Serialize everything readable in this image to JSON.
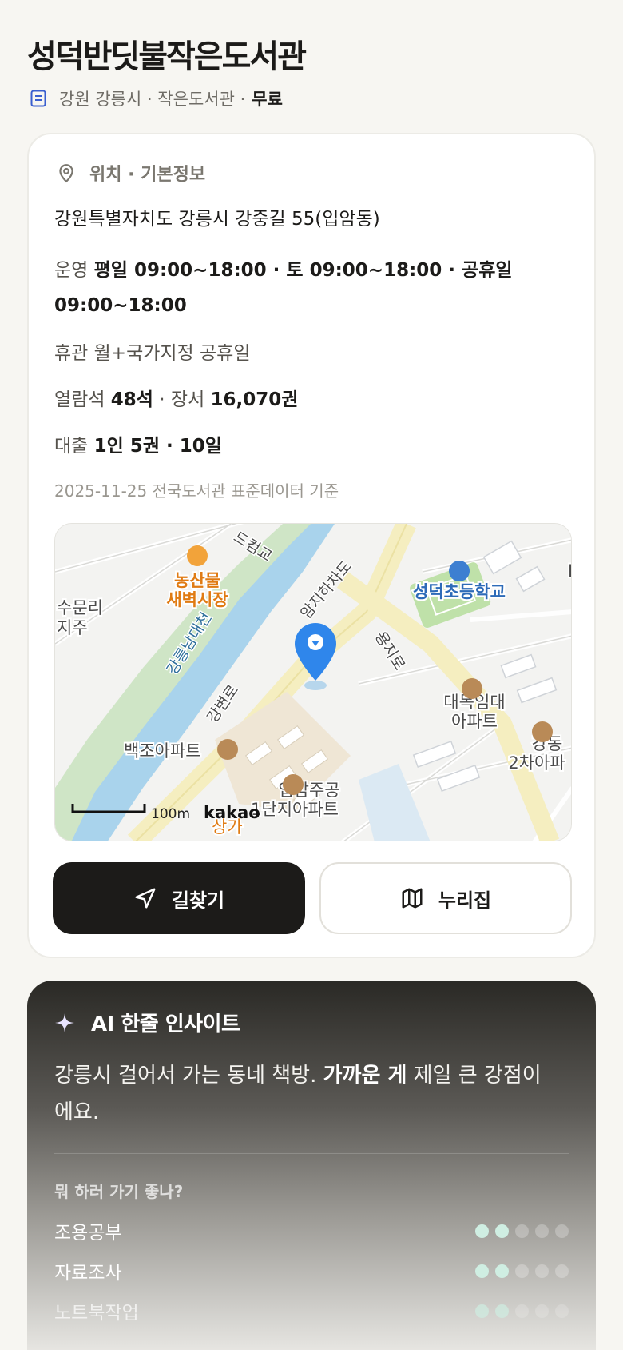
{
  "library": {
    "name": "성덕반딧불작은도서관",
    "meta_text": "강원 강릉시 · 작은도서관 ·",
    "fee": "무료"
  },
  "info": {
    "section_title": "위치 · 기본정보",
    "address": "강원특별자치도 강릉시 강중길 55(입암동)",
    "hours_label": "운영",
    "hours_value": "평일 09:00~18:00 · 토 09:00~18:00 · 공휴일 09:00~18:00",
    "closed_text": "휴관 월+국가지정 공휴일",
    "seats_label": "열람석",
    "seats_value": "48석",
    "books_label": "· 장서",
    "books_value": "16,070권",
    "loan_label": "대출",
    "loan_value": "1인 5권 · 10일",
    "source": "2025-11-25 전국도서관 표준데이터 기준"
  },
  "map": {
    "labels": {
      "nongsan": "농산물",
      "saebyeok": "새벽시장",
      "sumun": "수문리",
      "jiju": "지주",
      "river": "강릉남대천",
      "school": "성덕초등학교",
      "amji": "암지하차도",
      "yongji": "용지로",
      "daemok1": "대목임대",
      "daemok2": "아파트",
      "gangdong1": "강동",
      "gangdong2": "2차아파",
      "baekjo": "백조아파트",
      "gangbyeon": "강변로",
      "ipam1": "입암주공",
      "ipam2": "1단지아파트",
      "bridge": "드컴교",
      "sang": "상가",
      "scale": "100m",
      "brand": "kakao",
      "edge": "D"
    }
  },
  "buttons": {
    "directions": "길찾기",
    "nurizip": "누리집"
  },
  "ai": {
    "title": "AI 한줄 인사이트",
    "text_pre": "강릉시 걸어서 가는 동네 책방.",
    "text_bold": "가까운 게",
    "text_post": "제일 큰 강점이에요.",
    "question": "뭐 하러 가기 좋나?",
    "activities": [
      {
        "name": "조용공부",
        "level": 2,
        "max": 5
      },
      {
        "name": "자료조사",
        "level": 2,
        "max": 5
      },
      {
        "name": "노트북작업",
        "level": 2,
        "max": 5
      }
    ]
  },
  "colors": {
    "background": "#f7f6f2",
    "primary_button": "#1c1b19",
    "map_pin": "#2f86eb",
    "dot_on": "#cfeee2"
  }
}
